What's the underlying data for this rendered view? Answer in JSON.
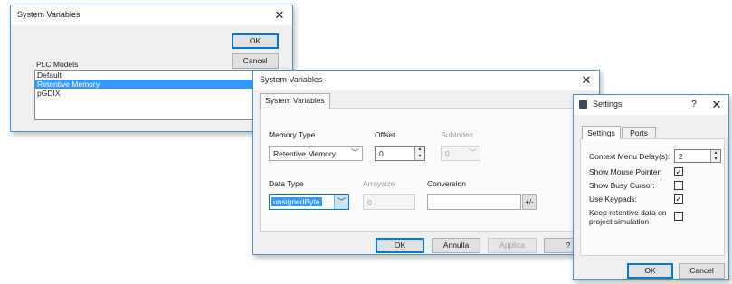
{
  "dialog1": {
    "title": "System Variables",
    "close_glyph": "✕",
    "ok_label": "OK",
    "cancel_label": "Cancel",
    "list_label": "PLC Models",
    "models": [
      "Default",
      "Retentive Memory",
      "pGDIX"
    ],
    "selected_index": 1
  },
  "dialog2": {
    "title": "System Variables",
    "close_glyph": "✕",
    "tab_label": "System Variables",
    "memory_type_label": "Memory Type",
    "memory_type_value": "Retentive Memory",
    "offset_label": "Offset",
    "offset_value": "0",
    "subindex_label": "SubIndex",
    "subindex_value": "0",
    "data_type_label": "Data Type",
    "data_type_value": "unsignedByte",
    "arraysize_label": "Arraysize",
    "arraysize_value": "0",
    "conversion_label": "Conversion",
    "conversion_button": "+/-",
    "ok_label": "OK",
    "annulla_label": "Annulla",
    "applica_label": "Applica",
    "help_label": "?"
  },
  "dialog3": {
    "title": "Settings",
    "help_glyph": "?",
    "close_glyph": "✕",
    "tabs": [
      "Settings",
      "Ports"
    ],
    "context_menu_label": "Context Menu Delay(s):",
    "context_menu_value": "2",
    "show_mouse_label": "Show Mouse Pointer:",
    "show_mouse_checked": true,
    "show_busy_label": "Show Busy Cursor:",
    "show_busy_checked": false,
    "use_keypads_label": "Use Keypads:",
    "use_keypads_checked": true,
    "keep_retentive_label_line1": "Keep retentive data on",
    "keep_retentive_label_line2": "project simulation",
    "keep_retentive_checked": false,
    "check_glyph": "✓",
    "ok_label": "OK",
    "cancel_label": "Cancel"
  },
  "colors": {
    "accent": "#0078d7",
    "selection": "#3399ff",
    "border_blue": "#4a8fd6"
  }
}
